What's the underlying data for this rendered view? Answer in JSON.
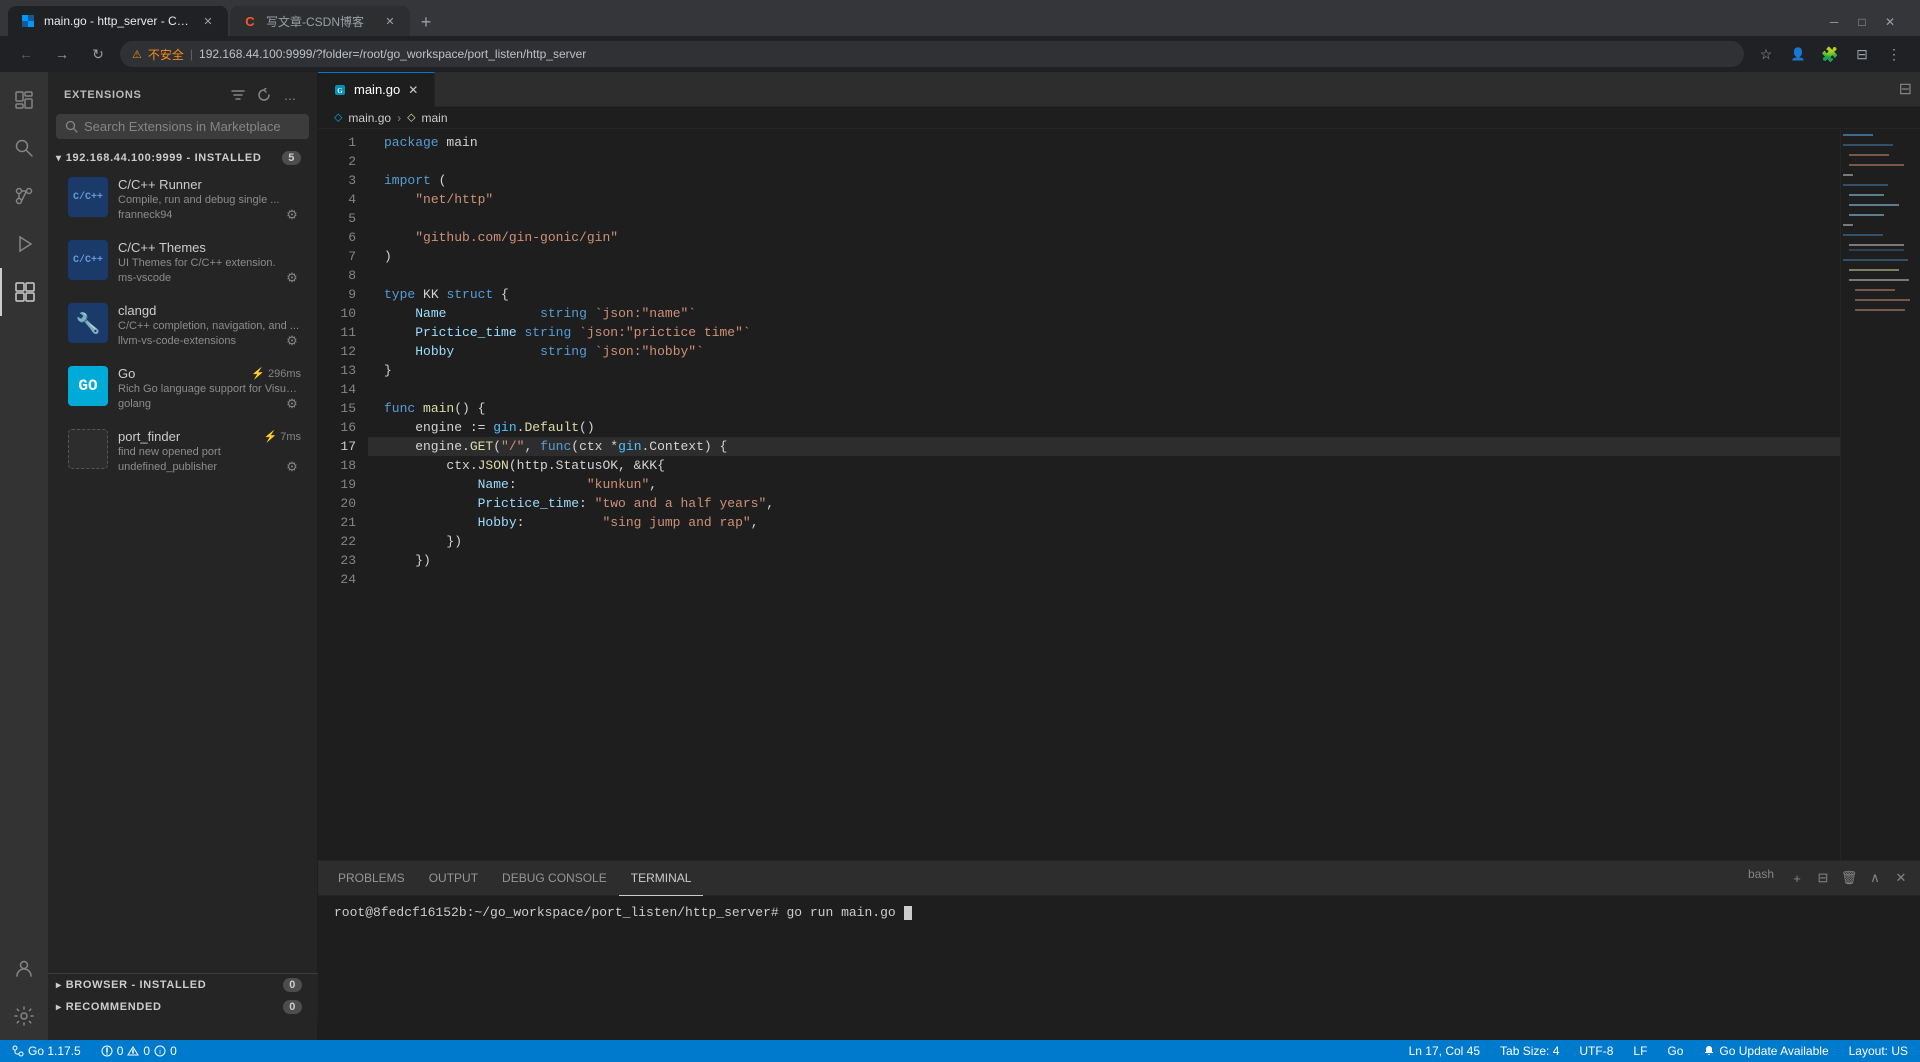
{
  "browser": {
    "tabs": [
      {
        "id": "tab-vscode",
        "favicon": "⬜",
        "favicon_color": "#0098ff",
        "title": "main.go - http_server - Code",
        "active": true
      },
      {
        "id": "tab-csdn",
        "favicon": "✍",
        "favicon_color": "#FC5531",
        "title": "写文章-CSDN博客",
        "active": false
      }
    ],
    "new_tab_label": "+",
    "window_controls": [
      "─",
      "□",
      "✕"
    ],
    "toolbar": {
      "back": "←",
      "forward": "→",
      "refresh": "↻",
      "security_label": "不安全",
      "url": "192.168.44.100:9999/?folder=/root/go_workspace/port_listen/http_server",
      "bookmark": "☆",
      "extensions": "🧩",
      "split": "⊟",
      "profile": "👤",
      "menu": "⋮"
    }
  },
  "vscode": {
    "activity_bar": {
      "items": [
        {
          "id": "explorer",
          "icon": "☰",
          "label": "Explorer"
        },
        {
          "id": "search",
          "icon": "🔍",
          "label": "Search"
        },
        {
          "id": "git",
          "icon": "⎇",
          "label": "Source Control"
        },
        {
          "id": "debug",
          "icon": "▷",
          "label": "Run and Debug"
        },
        {
          "id": "extensions",
          "icon": "⧉",
          "label": "Extensions",
          "active": true
        },
        {
          "id": "account",
          "icon": "👤",
          "label": "Account",
          "bottom": true
        },
        {
          "id": "settings",
          "icon": "⚙",
          "label": "Settings",
          "bottom": true
        }
      ]
    },
    "sidebar": {
      "title": "EXTENSIONS",
      "search_placeholder": "Search Extensions in Marketplace",
      "actions": [
        "filter",
        "refresh",
        "more"
      ],
      "installed_section": {
        "label": "192.168.44.100:9999 - INSTALLED",
        "badge": "5",
        "extensions": [
          {
            "id": "cpp-runner",
            "name": "C/C++ Runner",
            "description": "Compile, run and debug single ...",
            "publisher": "franneck94",
            "has_gear": true,
            "icon_type": "cpp",
            "icon_text": "C/C++"
          },
          {
            "id": "cpp-themes",
            "name": "C/C++ Themes",
            "description": "UI Themes for C/C++ extension.",
            "publisher": "ms-vscode",
            "has_gear": true,
            "icon_type": "cpp",
            "icon_text": "C/C++"
          },
          {
            "id": "clangd",
            "name": "clangd",
            "description": "C/C++ completion, navigation, and ...",
            "publisher": "llvm-vs-code-extensions",
            "has_gear": true,
            "icon_type": "clangd",
            "icon_text": "🔧"
          },
          {
            "id": "go",
            "name": "Go",
            "description": "Rich Go language support for Visual...",
            "publisher": "golang",
            "has_gear": true,
            "size_label": "296ms",
            "icon_type": "go",
            "icon_text": "GO"
          },
          {
            "id": "port-finder",
            "name": "port_finder",
            "description": "find new opened port",
            "publisher": "undefined_publisher",
            "has_gear": true,
            "size_label": "7ms",
            "icon_type": "port",
            "icon_text": ""
          }
        ]
      },
      "bottom_sections": [
        {
          "id": "browser-installed",
          "label": "BROWSER - INSTALLED",
          "badge": "0",
          "expanded": false
        },
        {
          "id": "recommended",
          "label": "RECOMMENDED",
          "badge": "0",
          "expanded": false
        }
      ]
    },
    "editor": {
      "tabs": [
        {
          "id": "main-go",
          "filename": "main.go",
          "active": true,
          "modified": false
        }
      ],
      "breadcrumb": [
        "main.go",
        "main"
      ],
      "breadcrumb_icons": [
        "⬦",
        "⬦"
      ],
      "code_lines": [
        {
          "num": 1,
          "content": "package main",
          "tokens": [
            {
              "t": "kw",
              "v": "package"
            },
            {
              "t": "plain",
              "v": " main"
            }
          ]
        },
        {
          "num": 2,
          "content": "",
          "tokens": []
        },
        {
          "num": 3,
          "content": "import (",
          "tokens": [
            {
              "t": "kw",
              "v": "import"
            },
            {
              "t": "plain",
              "v": " ("
            }
          ]
        },
        {
          "num": 4,
          "content": "    \"net/http\"",
          "tokens": [
            {
              "t": "plain",
              "v": "    "
            },
            {
              "t": "str",
              "v": "\"net/http\""
            }
          ]
        },
        {
          "num": 5,
          "content": "",
          "tokens": []
        },
        {
          "num": 6,
          "content": "    \"github.com/gin-gonic/gin\"",
          "tokens": [
            {
              "t": "plain",
              "v": "    "
            },
            {
              "t": "str",
              "v": "\"github.com/gin-gonic/gin\""
            }
          ]
        },
        {
          "num": 7,
          "content": ")",
          "tokens": [
            {
              "t": "plain",
              "v": ")"
            }
          ]
        },
        {
          "num": 8,
          "content": "",
          "tokens": []
        },
        {
          "num": 9,
          "content": "type KK struct {",
          "tokens": [
            {
              "t": "kw",
              "v": "type"
            },
            {
              "t": "plain",
              "v": " KK "
            },
            {
              "t": "kw",
              "v": "struct"
            },
            {
              "t": "plain",
              "v": " {"
            }
          ]
        },
        {
          "num": 10,
          "content": "    Name            string `json:\"name\"`",
          "tokens": [
            {
              "t": "plain",
              "v": "    "
            },
            {
              "t": "field",
              "v": "Name"
            },
            {
              "t": "plain",
              "v": "            "
            },
            {
              "t": "kw",
              "v": "string"
            },
            {
              "t": "str",
              "v": " `json:\"name\"`"
            }
          ]
        },
        {
          "num": 11,
          "content": "    Prictice_time   string `json:\"prictice time\"`",
          "tokens": [
            {
              "t": "plain",
              "v": "    "
            },
            {
              "t": "field",
              "v": "Prictice_time"
            },
            {
              "t": "plain",
              "v": "   "
            },
            {
              "t": "kw",
              "v": "string"
            },
            {
              "t": "str",
              "v": " `json:\"prictice time\"`"
            }
          ]
        },
        {
          "num": 12,
          "content": "    Hobby            string `json:\"hobby\"`",
          "tokens": [
            {
              "t": "plain",
              "v": "    "
            },
            {
              "t": "field",
              "v": "Hobby"
            },
            {
              "t": "plain",
              "v": "            "
            },
            {
              "t": "kw",
              "v": "string"
            },
            {
              "t": "str",
              "v": " `json:\"hobby\"`"
            }
          ]
        },
        {
          "num": 13,
          "content": "}",
          "tokens": [
            {
              "t": "plain",
              "v": "}"
            }
          ]
        },
        {
          "num": 14,
          "content": "",
          "tokens": []
        },
        {
          "num": 15,
          "content": "func main() {",
          "tokens": [
            {
              "t": "kw",
              "v": "func"
            },
            {
              "t": "plain",
              "v": " "
            },
            {
              "t": "fn",
              "v": "main"
            },
            {
              "t": "plain",
              "v": "() {"
            }
          ]
        },
        {
          "num": 16,
          "content": "    engine := gin.Default()",
          "tokens": [
            {
              "t": "plain",
              "v": "    engine := "
            },
            {
              "t": "pkg",
              "v": "gin"
            },
            {
              "t": "plain",
              "v": "."
            },
            {
              "t": "fn",
              "v": "Default"
            },
            {
              "t": "plain",
              "v": "()"
            }
          ]
        },
        {
          "num": 17,
          "content": "    engine.GET(\"/\", func(ctx *gin.Context) {",
          "tokens": [
            {
              "t": "plain",
              "v": "    engine."
            },
            {
              "t": "fn",
              "v": "GET"
            },
            {
              "t": "plain",
              "v": "("
            },
            {
              "t": "str",
              "v": "\"/\""
            },
            {
              "t": "plain",
              "v": ", "
            },
            {
              "t": "kw",
              "v": "func"
            },
            {
              "t": "plain",
              "v": "(ctx *"
            },
            {
              "t": "pkg",
              "v": "gin"
            },
            {
              "t": "plain",
              "v": ".Context) {"
            }
          ],
          "highlighted": true
        },
        {
          "num": 18,
          "content": "        ctx.JSON(http.StatusOK, &KK{",
          "tokens": [
            {
              "t": "plain",
              "v": "        ctx."
            },
            {
              "t": "fn",
              "v": "JSON"
            },
            {
              "t": "plain",
              "v": "(http.StatusOK, &KK{"
            }
          ]
        },
        {
          "num": 19,
          "content": "            Name:         \"kunkun\",",
          "tokens": [
            {
              "t": "plain",
              "v": "            "
            },
            {
              "t": "field",
              "v": "Name"
            },
            {
              "t": "plain",
              "v": ":         "
            },
            {
              "t": "str",
              "v": "\"kunkun\""
            },
            {
              "t": "plain",
              "v": ","
            }
          ]
        },
        {
          "num": 20,
          "content": "            Prictice_time: \"two and a half years\",",
          "tokens": [
            {
              "t": "plain",
              "v": "            "
            },
            {
              "t": "field",
              "v": "Prictice_time"
            },
            {
              "t": "plain",
              "v": ": "
            },
            {
              "t": "str",
              "v": "\"two and a half years\""
            },
            {
              "t": "plain",
              "v": ","
            }
          ]
        },
        {
          "num": 21,
          "content": "            Hobby:          \"sing jump and rap\",",
          "tokens": [
            {
              "t": "plain",
              "v": "            "
            },
            {
              "t": "field",
              "v": "Hobby"
            },
            {
              "t": "plain",
              "v": ":          "
            },
            {
              "t": "str",
              "v": "\"sing jump and rap\""
            },
            {
              "t": "plain",
              "v": ","
            }
          ]
        },
        {
          "num": 22,
          "content": "        })",
          "tokens": [
            {
              "t": "plain",
              "v": "        })"
            }
          ]
        },
        {
          "num": 23,
          "content": "    })",
          "tokens": [
            {
              "t": "plain",
              "v": "    })"
            }
          ]
        },
        {
          "num": 24,
          "content": "",
          "tokens": []
        }
      ]
    },
    "panel": {
      "tabs": [
        {
          "id": "problems",
          "label": "PROBLEMS",
          "active": false
        },
        {
          "id": "output",
          "label": "OUTPUT",
          "active": false
        },
        {
          "id": "debug-console",
          "label": "DEBUG CONSOLE",
          "active": false
        },
        {
          "id": "terminal",
          "label": "TERMINAL",
          "active": true
        }
      ],
      "terminal_bash_label": "bash",
      "terminal_content": "root@8fedcf16152b:~/go_workspace/port_listen/http_server# go run main.go ",
      "terminal_actions": [
        "+",
        "⊟",
        "🗑",
        "∧",
        "✕"
      ]
    },
    "status_bar": {
      "git_branch": "Go 1.17.5",
      "errors": "0",
      "warnings": "0",
      "alerts": "0",
      "cursor_position": "Ln 17, Col 45",
      "tab_size": "Tab Size: 4",
      "encoding": "UTF-8",
      "line_ending": "LF",
      "language": "Go",
      "update_label": "Go Update Available",
      "layout_label": "Layout: US"
    }
  }
}
